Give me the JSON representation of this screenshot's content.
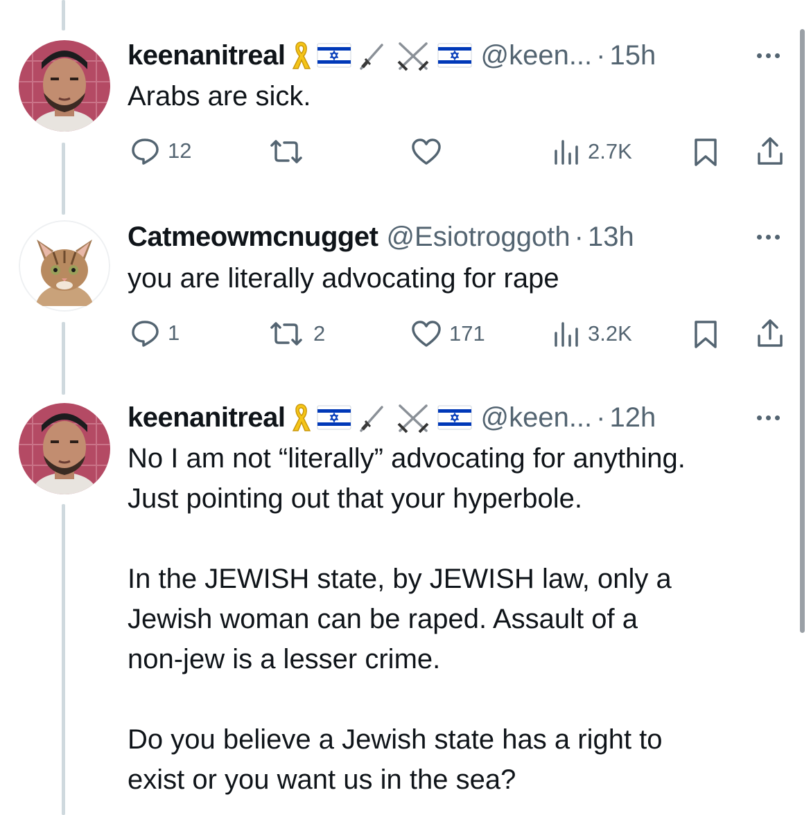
{
  "tweets": [
    {
      "display_name": "keenanitreal",
      "handle": "@keen...",
      "time": "15h",
      "badges": [
        "yellow-ribbon",
        "israel-flag",
        "dagger",
        "crossed-swords",
        "israel-flag"
      ],
      "paragraphs": [
        "Arabs are sick."
      ],
      "actions": {
        "replies": "12",
        "reposts": "",
        "likes": "",
        "views": "2.7K"
      }
    },
    {
      "display_name": "Catmeowmcnugget",
      "handle": "@Esiotroggoth",
      "time": "13h",
      "paragraphs": [
        "you are literally advocating for rape"
      ],
      "actions": {
        "replies": "1",
        "reposts": "2",
        "likes": "171",
        "views": "3.2K"
      }
    },
    {
      "display_name": "keenanitreal",
      "handle": "@keen...",
      "time": "12h",
      "badges": [
        "yellow-ribbon",
        "israel-flag",
        "dagger",
        "crossed-swords",
        "israel-flag"
      ],
      "paragraphs": [
        "No I am not “literally” advocating for anything.\nJust pointing out that your hyperbole.",
        "In the JEWISH state, by JEWISH law, only a\nJewish woman can be raped.  Assault of a\nnon-jew is a lesser crime.",
        "Do you believe a Jewish state has a right to\nexist or you want us in the sea?"
      ]
    }
  ],
  "separator": "·",
  "icons": [
    "reply-icon",
    "repost-icon",
    "like-icon",
    "views-icon",
    "bookmark-icon",
    "share-icon",
    "more-icon"
  ],
  "colors": {
    "text": "#0f1419",
    "secondary": "#536471",
    "thread_line": "#cfd9de",
    "flag_blue": "#0038b8",
    "ribbon_yellow": "#f5c518"
  }
}
